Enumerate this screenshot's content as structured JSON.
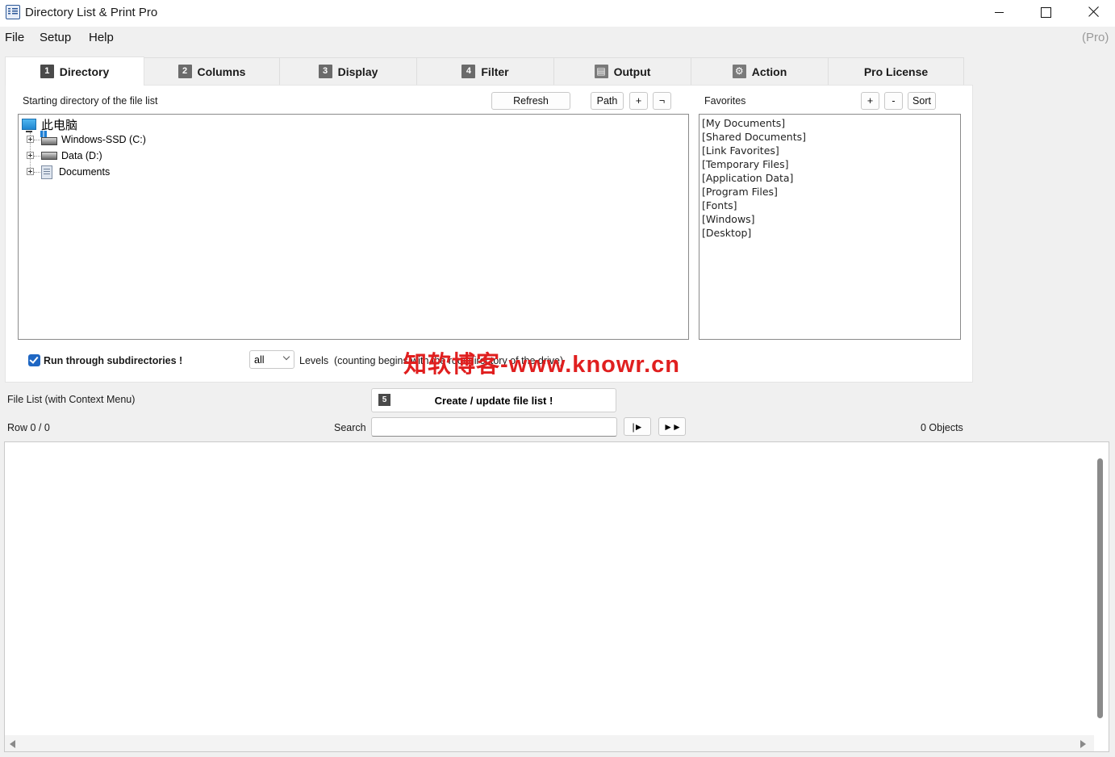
{
  "window": {
    "title": "Directory List & Print Pro",
    "controls": {
      "minimize": "minimize-icon",
      "maximize": "maximize-icon",
      "close": "close-icon"
    }
  },
  "menu": {
    "items": [
      "File",
      "Setup",
      "Help"
    ],
    "edition": "(Pro)"
  },
  "tabs": [
    {
      "num": "1",
      "label": "Directory",
      "active": true
    },
    {
      "num": "2",
      "label": "Columns"
    },
    {
      "num": "3",
      "label": "Display"
    },
    {
      "num": "4",
      "label": "Filter"
    },
    {
      "icon": "output-icon",
      "label": "Output"
    },
    {
      "icon": "gear-icon",
      "label": "Action"
    },
    {
      "label": "Pro License"
    }
  ],
  "directory": {
    "label": "Starting directory of the file list",
    "refresh": "Refresh",
    "path": "Path",
    "plus": "+",
    "not": "¬",
    "tree": {
      "root": "此电脑",
      "children": [
        "Windows-SSD (C:)",
        "Data (D:)",
        "Documents"
      ]
    }
  },
  "favorites": {
    "label": "Favorites",
    "plus": "+",
    "minus": "-",
    "sort": "Sort",
    "items": [
      "[My Documents]",
      "[Shared Documents]",
      "[Link Favorites]",
      "[Temporary Files]",
      "[Application Data]",
      "[Program Files]",
      "[Fonts]",
      "[Windows]",
      "[Desktop]"
    ]
  },
  "options": {
    "subdirs_label": "Run through subdirectories !",
    "subdirs_checked": true,
    "levels_value": "all",
    "levels_label": "Levels",
    "levels_note": "(counting begins with the root directory of the drive)"
  },
  "watermark": "知软博客-www.knowr.cn",
  "filelist": {
    "label": "File List (with Context Menu)",
    "create_num": "5",
    "create_label": "Create / update file list !",
    "row_status": "Row 0 / 0",
    "search_label": "Search",
    "search_value": "",
    "next_label": "|►",
    "next_all_label": "►►",
    "objects": "0 Objects"
  },
  "colors": {
    "accent": "#1f67c3",
    "watermark": "#e01f1f"
  }
}
